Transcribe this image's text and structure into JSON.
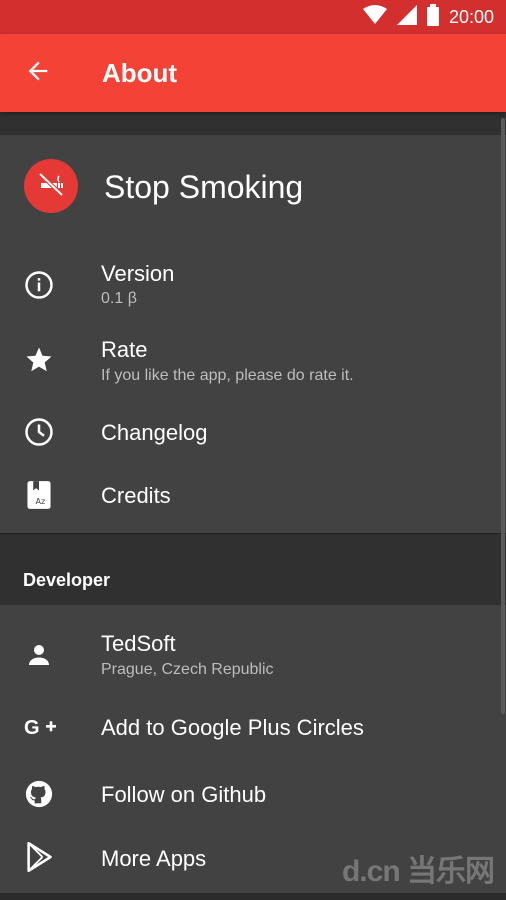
{
  "status_bar": {
    "time": "20:00",
    "icons": [
      "wifi-icon",
      "signal-icon",
      "battery-icon"
    ],
    "color": "#d32f2f"
  },
  "app_bar": {
    "title": "About",
    "back_icon": "arrow-back-icon",
    "color": "#f44336"
  },
  "app_info": {
    "name": "Stop Smoking",
    "logo_icon": "no-smoking-icon",
    "logo_color": "#e53935"
  },
  "items": [
    {
      "icon": "info-icon",
      "title": "Version",
      "subtitle": "0.1 β"
    },
    {
      "icon": "star-icon",
      "title": "Rate",
      "subtitle": "If you like the app, please do rate it."
    },
    {
      "icon": "clock-icon",
      "title": "Changelog"
    },
    {
      "icon": "credits-icon",
      "title": "Credits"
    }
  ],
  "developer_section": {
    "header": "Developer",
    "items": [
      {
        "icon": "person-icon",
        "title": "TedSoft",
        "subtitle": "Prague, Czech Republic"
      },
      {
        "icon": "google-plus-icon",
        "title": "Add to Google Plus Circles"
      },
      {
        "icon": "github-icon",
        "title": "Follow on Github"
      },
      {
        "icon": "play-store-icon",
        "title": "More Apps"
      }
    ]
  },
  "watermark": "d.cn 当乐网",
  "colors": {
    "background": "#303030",
    "card": "#424242",
    "secondary_text": "#bdbdbd"
  }
}
